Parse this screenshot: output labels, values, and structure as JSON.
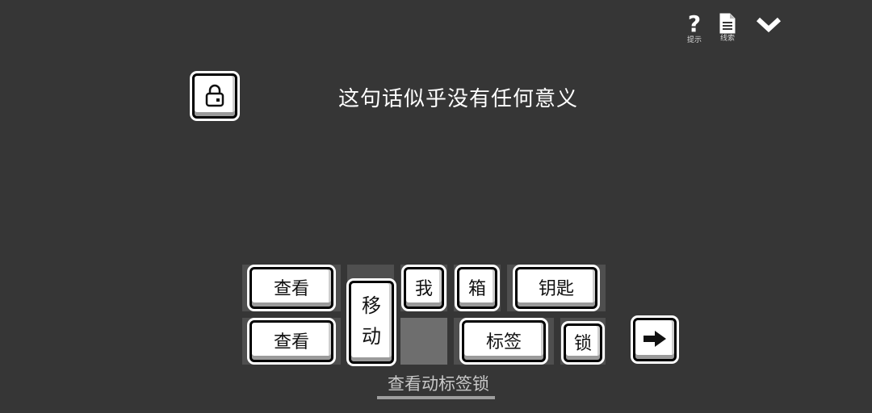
{
  "toolbar": {
    "hint": {
      "glyph": "?",
      "label": "提示",
      "icon": "question-mark-icon"
    },
    "clues": {
      "label": "线索",
      "icon": "document-icon"
    },
    "collapse": {
      "icon": "chevron-down-icon"
    }
  },
  "puzzle": {
    "lock_icon": "padlock-icon",
    "sentence": "这句话似乎没有任何意义"
  },
  "word_tiles": {
    "row1": {
      "look": "查看",
      "me": "我",
      "box": "箱",
      "key": "钥匙"
    },
    "move": {
      "top": "移",
      "bottom": "动"
    },
    "row2": {
      "look": "查看",
      "tag": "标签",
      "lock": "锁"
    }
  },
  "submit": {
    "icon": "right-arrow-icon"
  },
  "combination": {
    "text": "查看动标签锁"
  }
}
